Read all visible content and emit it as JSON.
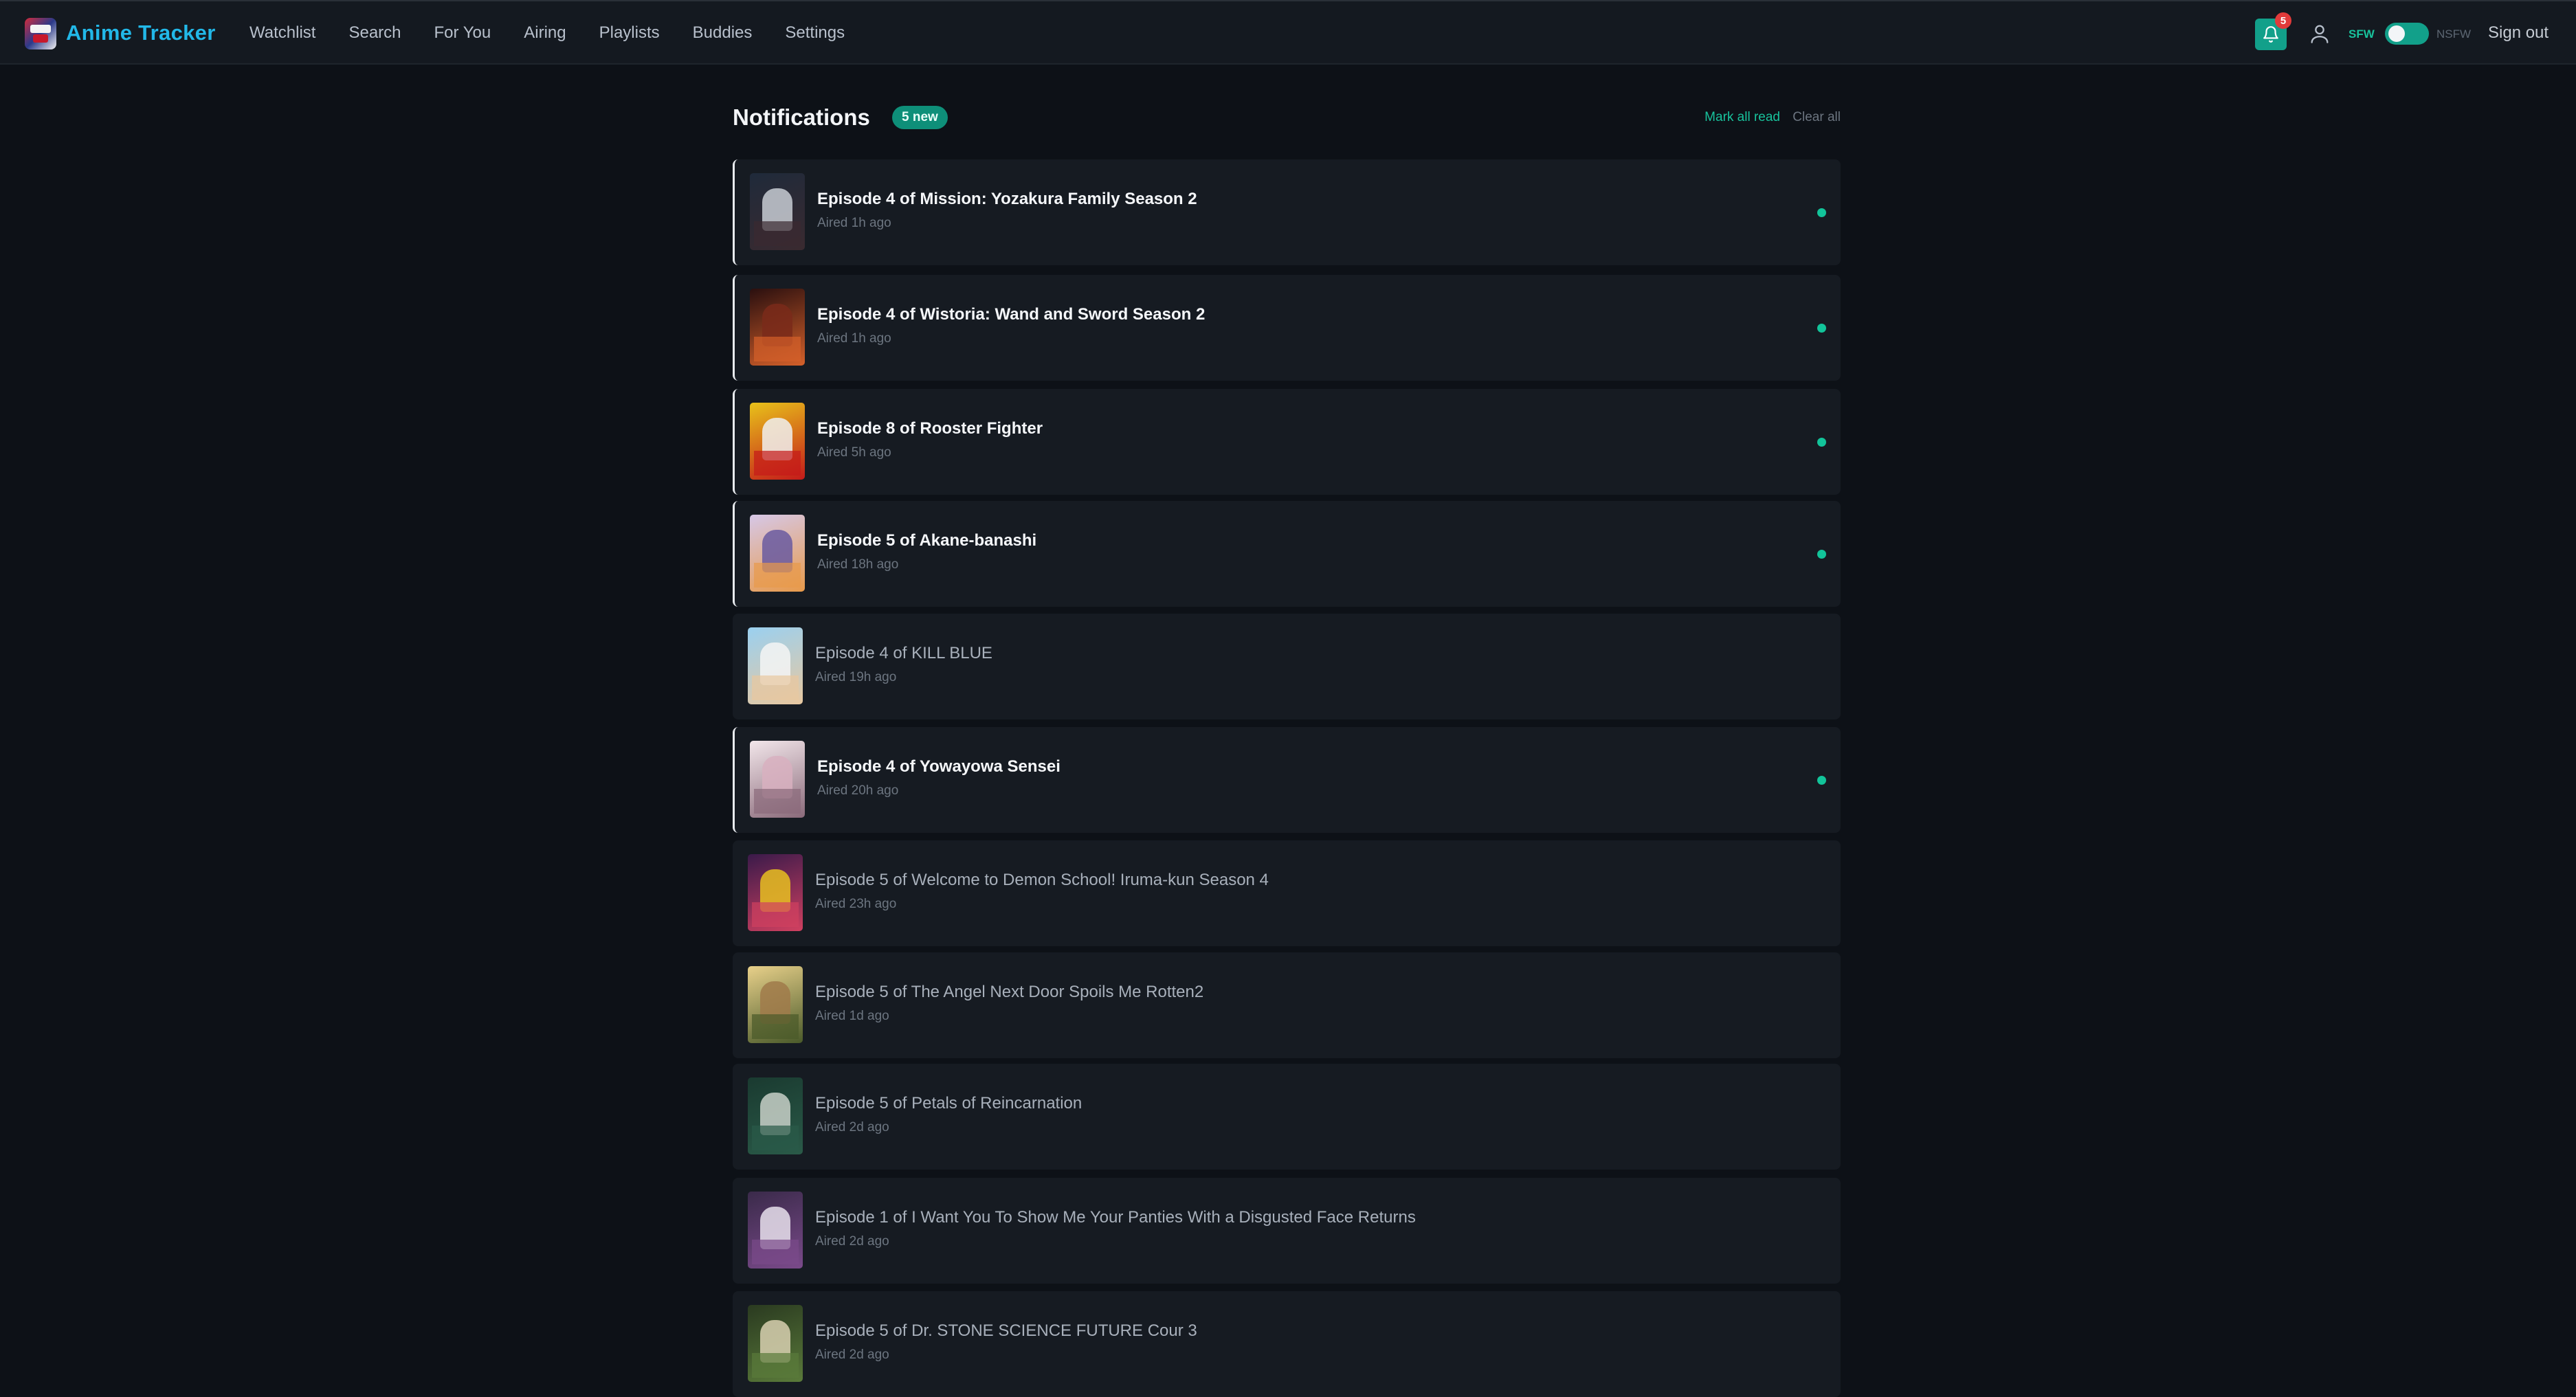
{
  "app": {
    "title": "Anime Tracker",
    "accent": "#22b8e8",
    "teal": "#12a08a"
  },
  "nav": {
    "links": [
      "Watchlist",
      "Search",
      "For You",
      "Airing",
      "Playlists",
      "Buddies",
      "Settings"
    ],
    "bell_count": "5",
    "sfw_label": "SFW",
    "nsfw_label": "NSFW",
    "signout_label": "Sign out",
    "sfw_enabled": true
  },
  "notifications": {
    "title": "Notifications",
    "new_badge": "5 new",
    "mark_all_read": "Mark all read",
    "clear_all": "Clear all",
    "items": [
      {
        "title": "Episode 4 of Mission: Yozakura Family Season 2",
        "time": "Aired 1h ago",
        "unread": true,
        "colors": [
          "#1f2a3a",
          "#c8ccd4",
          "#3a2a30"
        ]
      },
      {
        "title": "Episode 4 of Wistoria: Wand and Sword Season 2",
        "time": "Aired 1h ago",
        "unread": true,
        "colors": [
          "#2a0f0f",
          "#7a2a1a",
          "#d4602a"
        ]
      },
      {
        "title": "Episode 8 of Rooster Fighter",
        "time": "Aired 5h ago",
        "unread": true,
        "colors": [
          "#e8c21a",
          "#f0f0f0",
          "#c41a1a"
        ]
      },
      {
        "title": "Episode 5 of Akane-banashi",
        "time": "Aired 18h ago",
        "unread": true,
        "colors": [
          "#d6c8e8",
          "#6a5aa0",
          "#e89a4a"
        ]
      },
      {
        "title": "Episode 4 of KILL BLUE",
        "time": "Aired 19h ago",
        "unread": false,
        "colors": [
          "#9ad0f0",
          "#f4f4f4",
          "#e8c8a0"
        ]
      },
      {
        "title": "Episode 4 of Yowayowa Sensei",
        "time": "Aired 20h ago",
        "unread": true,
        "colors": [
          "#f2e6ea",
          "#d8b0c0",
          "#8a6a7a"
        ]
      },
      {
        "title": "Episode 5 of Welcome to Demon School! Iruma-kun Season 4",
        "time": "Aired 23h ago",
        "unread": false,
        "colors": [
          "#3a1a4a",
          "#e8c020",
          "#d04060"
        ]
      },
      {
        "title": "Episode 5 of The Angel Next Door Spoils Me Rotten2",
        "time": "Aired 1d ago",
        "unread": false,
        "colors": [
          "#e8d08a",
          "#a07a4a",
          "#4a5a2a"
        ]
      },
      {
        "title": "Episode 5 of Petals of Reincarnation",
        "time": "Aired 2d ago",
        "unread": false,
        "colors": [
          "#1a3a30",
          "#c8d0c8",
          "#2a5a48"
        ]
      },
      {
        "title": "Episode 1 of I Want You To Show Me Your Panties With a Disgusted Face Returns",
        "time": "Aired 2d ago",
        "unread": false,
        "colors": [
          "#3a2a4a",
          "#e8e0ec",
          "#7a4a8a"
        ]
      },
      {
        "title": "Episode 5 of Dr. STONE SCIENCE FUTURE Cour 3",
        "time": "Aired 2d ago",
        "unread": false,
        "colors": [
          "#2a3a20",
          "#d8d0b0",
          "#5a7a3a"
        ]
      }
    ]
  }
}
